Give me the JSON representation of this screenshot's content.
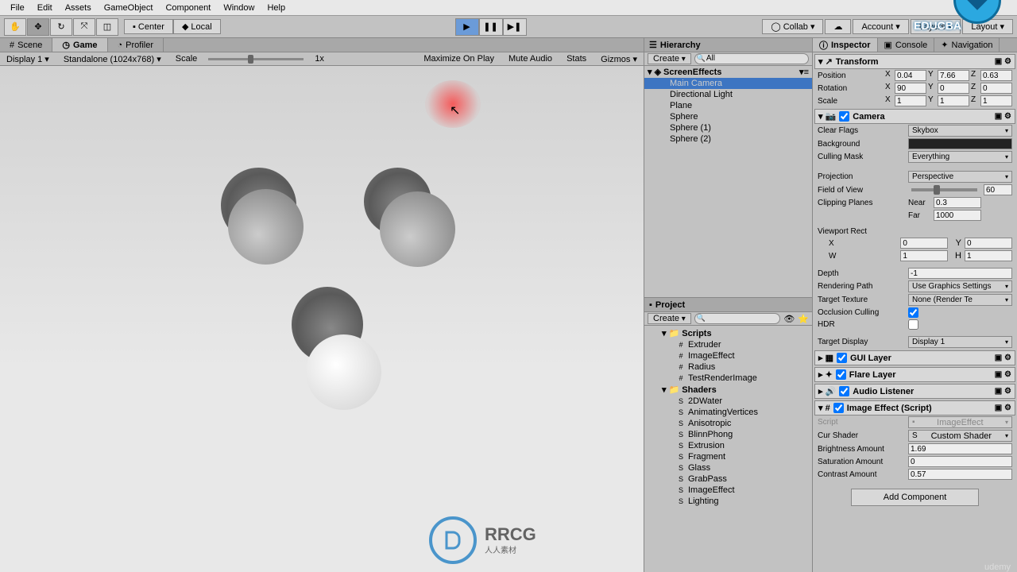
{
  "menu": [
    "File",
    "Edit",
    "Assets",
    "GameObject",
    "Component",
    "Window",
    "Help"
  ],
  "toolbar": {
    "pivot": "Center",
    "space": "Local",
    "collab": "Collab",
    "account": "Account",
    "layers": "Layers",
    "layout": "Layout"
  },
  "tabs": {
    "scene": "Scene",
    "game": "Game",
    "profiler": "Profiler"
  },
  "game_bar": {
    "display": "Display 1",
    "res": "Standalone (1024x768)",
    "scale_label": "Scale",
    "scale_val": "1x",
    "max": "Maximize On Play",
    "mute": "Mute Audio",
    "stats": "Stats",
    "gizmos": "Gizmos"
  },
  "hierarchy": {
    "title": "Hierarchy",
    "create": "Create",
    "search_tag": "All",
    "root": "ScreenEffects",
    "items": [
      "Main Camera",
      "Directional Light",
      "Plane",
      "Sphere",
      "Sphere (1)",
      "Sphere (2)"
    ]
  },
  "project": {
    "title": "Project",
    "create": "Create",
    "folders": {
      "scripts": "Scripts",
      "scripts_items": [
        "Extruder",
        "ImageEffect",
        "Radius",
        "TestRenderImage"
      ],
      "shaders": "Shaders",
      "shaders_items": [
        "2DWater",
        "AnimatingVertices",
        "Anisotropic",
        "BlinnPhong",
        "Extrusion",
        "Fragment",
        "Glass",
        "GrabPass",
        "ImageEffect",
        "Lighting"
      ]
    }
  },
  "inspector": {
    "tabs": [
      "Inspector",
      "Console",
      "Navigation"
    ],
    "transform": {
      "title": "Transform",
      "pos_label": "Position",
      "px": "0.04",
      "py": "7.66",
      "pz": "0.63",
      "rot_label": "Rotation",
      "rx": "90",
      "ry": "0",
      "rz": "0",
      "scl_label": "Scale",
      "sx": "1",
      "sy": "1",
      "sz": "1"
    },
    "camera": {
      "title": "Camera",
      "clear_flags_label": "Clear Flags",
      "clear_flags": "Skybox",
      "background_label": "Background",
      "culling_label": "Culling Mask",
      "culling": "Everything",
      "projection_label": "Projection",
      "projection": "Perspective",
      "fov_label": "Field of View",
      "fov": "60",
      "clip_label": "Clipping Planes",
      "near_l": "Near",
      "near": "0.3",
      "far_l": "Far",
      "far": "1000",
      "viewport_label": "Viewport Rect",
      "vx": "0",
      "vy": "0",
      "vw": "1",
      "vh": "1",
      "depth_label": "Depth",
      "depth": "-1",
      "render_label": "Rendering Path",
      "render": "Use Graphics Settings",
      "target_tex_label": "Target Texture",
      "target_tex": "None (Render Te",
      "occl_label": "Occlusion Culling",
      "hdr_label": "HDR",
      "disp_label": "Target Display",
      "disp": "Display 1"
    },
    "gui_layer": "GUI Layer",
    "flare_layer": "Flare Layer",
    "audio_listener": "Audio Listener",
    "image_effect": {
      "title": "Image Effect (Script)",
      "script_label": "Script",
      "script": "ImageEffect",
      "shader_label": "Cur Shader",
      "shader": "Custom Shader",
      "bright_label": "Brightness Amount",
      "bright": "1.69",
      "sat_label": "Saturation Amount",
      "sat": "0",
      "contrast_label": "Contrast Amount",
      "contrast": "0.57"
    },
    "add_comp": "Add Component"
  },
  "watermark": {
    "brand": "RRCG",
    "sub": "人人素材"
  },
  "badge": "EDUCBA",
  "footer": "udemy"
}
